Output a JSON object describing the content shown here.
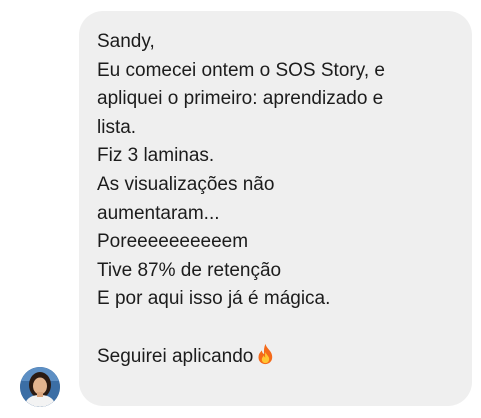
{
  "message": {
    "lines": [
      "Sandy,",
      "Eu comecei ontem o SOS Story, e",
      "apliquei o primeiro: aprendizado e",
      "lista.",
      "Fiz 3 laminas.",
      "As visualizações não",
      "aumentaram...",
      "Poreeeeeeeeeem",
      "Tive 87% de retenção",
      "E por aqui isso já é mágica.",
      "",
      "Seguirei aplicando"
    ],
    "trailing_icon": "fire-emoji-icon"
  },
  "sender": {
    "avatar_icon": "user-avatar"
  },
  "colors": {
    "bubble_bg": "#efefef",
    "text": "#1c1c1c",
    "fire": "#f46a1a"
  }
}
